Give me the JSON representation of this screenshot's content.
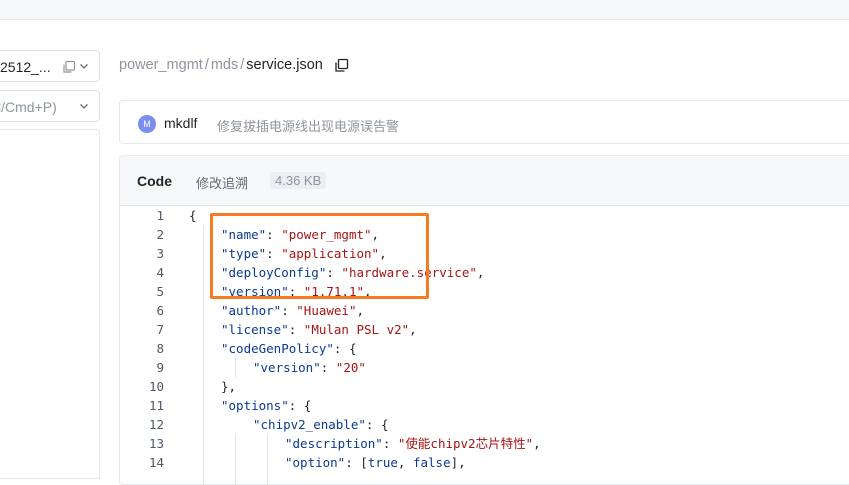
{
  "sidebar": {
    "branch_label": "2512_...",
    "search_placeholder": "l/Cmd+P)"
  },
  "breadcrumb": {
    "segments": [
      "power_mgmt",
      "mds"
    ],
    "separator": "/",
    "file": "service.json"
  },
  "commit": {
    "avatar_initial": "M",
    "author": "mkdlf",
    "message": "修复拔插电源线出现电源误告警"
  },
  "code_view": {
    "tab_code": "Code",
    "tab_blame": "修改追溯",
    "file_size": "4.36 KB",
    "lines": [
      {
        "n": "1",
        "tokens": [
          {
            "t": "p",
            "v": "{"
          }
        ],
        "indent": 0
      },
      {
        "n": "2",
        "tokens": [
          {
            "t": "k",
            "v": "\"name\""
          },
          {
            "t": "p",
            "v": ": "
          },
          {
            "t": "s",
            "v": "\"power_mgmt\""
          },
          {
            "t": "p",
            "v": ","
          }
        ],
        "indent": 1
      },
      {
        "n": "3",
        "tokens": [
          {
            "t": "k",
            "v": "\"type\""
          },
          {
            "t": "p",
            "v": ": "
          },
          {
            "t": "s",
            "v": "\"application\""
          },
          {
            "t": "p",
            "v": ","
          }
        ],
        "indent": 1
      },
      {
        "n": "4",
        "tokens": [
          {
            "t": "k",
            "v": "\"deployConfig\""
          },
          {
            "t": "p",
            "v": ": "
          },
          {
            "t": "s",
            "v": "\"hardware.service\""
          },
          {
            "t": "p",
            "v": ","
          }
        ],
        "indent": 1
      },
      {
        "n": "5",
        "tokens": [
          {
            "t": "k",
            "v": "\"version\""
          },
          {
            "t": "p",
            "v": ": "
          },
          {
            "t": "s",
            "v": "\"1.71.1\""
          },
          {
            "t": "p",
            "v": ","
          }
        ],
        "indent": 1
      },
      {
        "n": "6",
        "tokens": [
          {
            "t": "k",
            "v": "\"author\""
          },
          {
            "t": "p",
            "v": ": "
          },
          {
            "t": "s",
            "v": "\"Huawei\""
          },
          {
            "t": "p",
            "v": ","
          }
        ],
        "indent": 1
      },
      {
        "n": "7",
        "tokens": [
          {
            "t": "k",
            "v": "\"license\""
          },
          {
            "t": "p",
            "v": ": "
          },
          {
            "t": "s",
            "v": "\"Mulan PSL v2\""
          },
          {
            "t": "p",
            "v": ","
          }
        ],
        "indent": 1
      },
      {
        "n": "8",
        "tokens": [
          {
            "t": "k",
            "v": "\"codeGenPolicy\""
          },
          {
            "t": "p",
            "v": ": {"
          }
        ],
        "indent": 1
      },
      {
        "n": "9",
        "tokens": [
          {
            "t": "k",
            "v": "\"version\""
          },
          {
            "t": "p",
            "v": ": "
          },
          {
            "t": "s",
            "v": "\"20\""
          }
        ],
        "indent": 2
      },
      {
        "n": "10",
        "tokens": [
          {
            "t": "p",
            "v": "},"
          }
        ],
        "indent": 1
      },
      {
        "n": "11",
        "tokens": [
          {
            "t": "k",
            "v": "\"options\""
          },
          {
            "t": "p",
            "v": ": {"
          }
        ],
        "indent": 1
      },
      {
        "n": "12",
        "tokens": [
          {
            "t": "k",
            "v": "\"chipv2_enable\""
          },
          {
            "t": "p",
            "v": ": {"
          }
        ],
        "indent": 2
      },
      {
        "n": "13",
        "tokens": [
          {
            "t": "k",
            "v": "\"description\""
          },
          {
            "t": "p",
            "v": ": "
          },
          {
            "t": "s",
            "v": "\"使能chipv2芯片特性\""
          },
          {
            "t": "p",
            "v": ","
          }
        ],
        "indent": 3
      },
      {
        "n": "14",
        "tokens": [
          {
            "t": "k",
            "v": "\"option\""
          },
          {
            "t": "p",
            "v": ": ["
          },
          {
            "t": "b",
            "v": "true"
          },
          {
            "t": "p",
            "v": ", "
          },
          {
            "t": "b",
            "v": "false"
          },
          {
            "t": "p",
            "v": "],"
          }
        ],
        "indent": 3
      }
    ]
  },
  "colors": {
    "highlight": "#f57c22",
    "key": "#0b3a8f",
    "string": "#a31515"
  }
}
